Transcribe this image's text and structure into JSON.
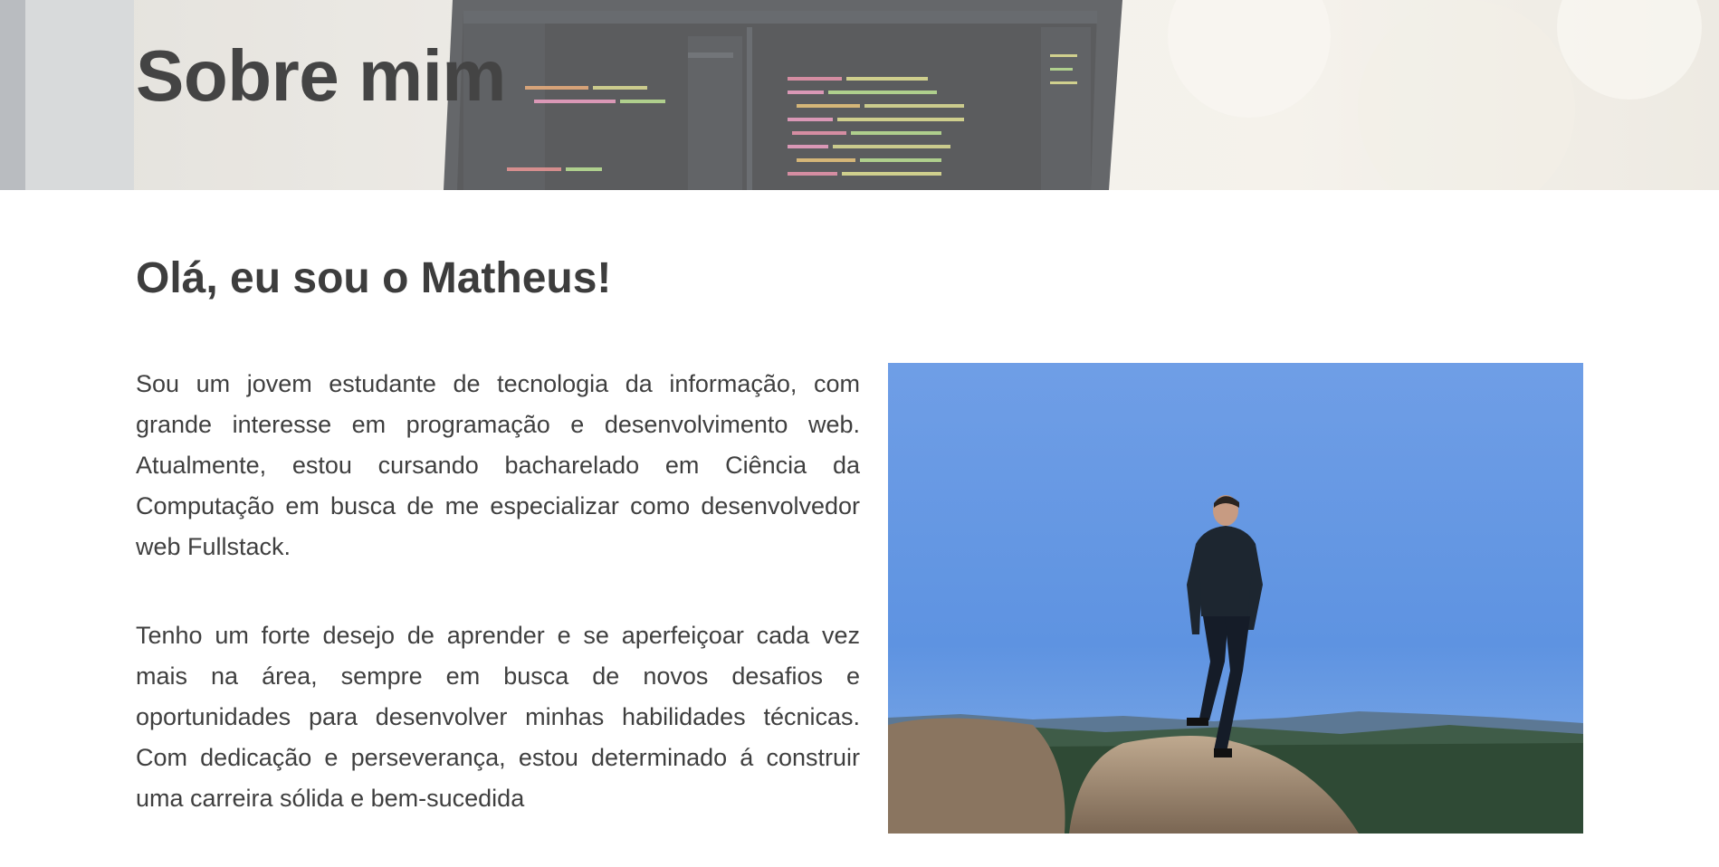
{
  "hero": {
    "title": "Sobre mim",
    "background": "laptop-code-photo"
  },
  "about": {
    "heading": "Olá, eu sou o Matheus!",
    "paragraphs": [
      "Sou um jovem estudante de tecnologia da informação, com grande interesse em programação e desenvolvimento web. Atualmente, estou cursando bacharelado em Ciência da Computação em busca de me especializar como desenvolvedor web Fullstack.",
      "Tenho um forte desejo de aprender e se aperfeiçoar cada vez mais na área, sempre em busca de novos desafios e oportunidades para desenvolver minhas habilidades técnicas. Com dedicação e perseverança, estou determinado á construir uma carreira sólida e bem-sucedida"
    ],
    "photo": "person-on-rock-photo"
  },
  "colors": {
    "text": "#3d3d3d",
    "sky": "#5e95e3",
    "background": "#ffffff"
  }
}
